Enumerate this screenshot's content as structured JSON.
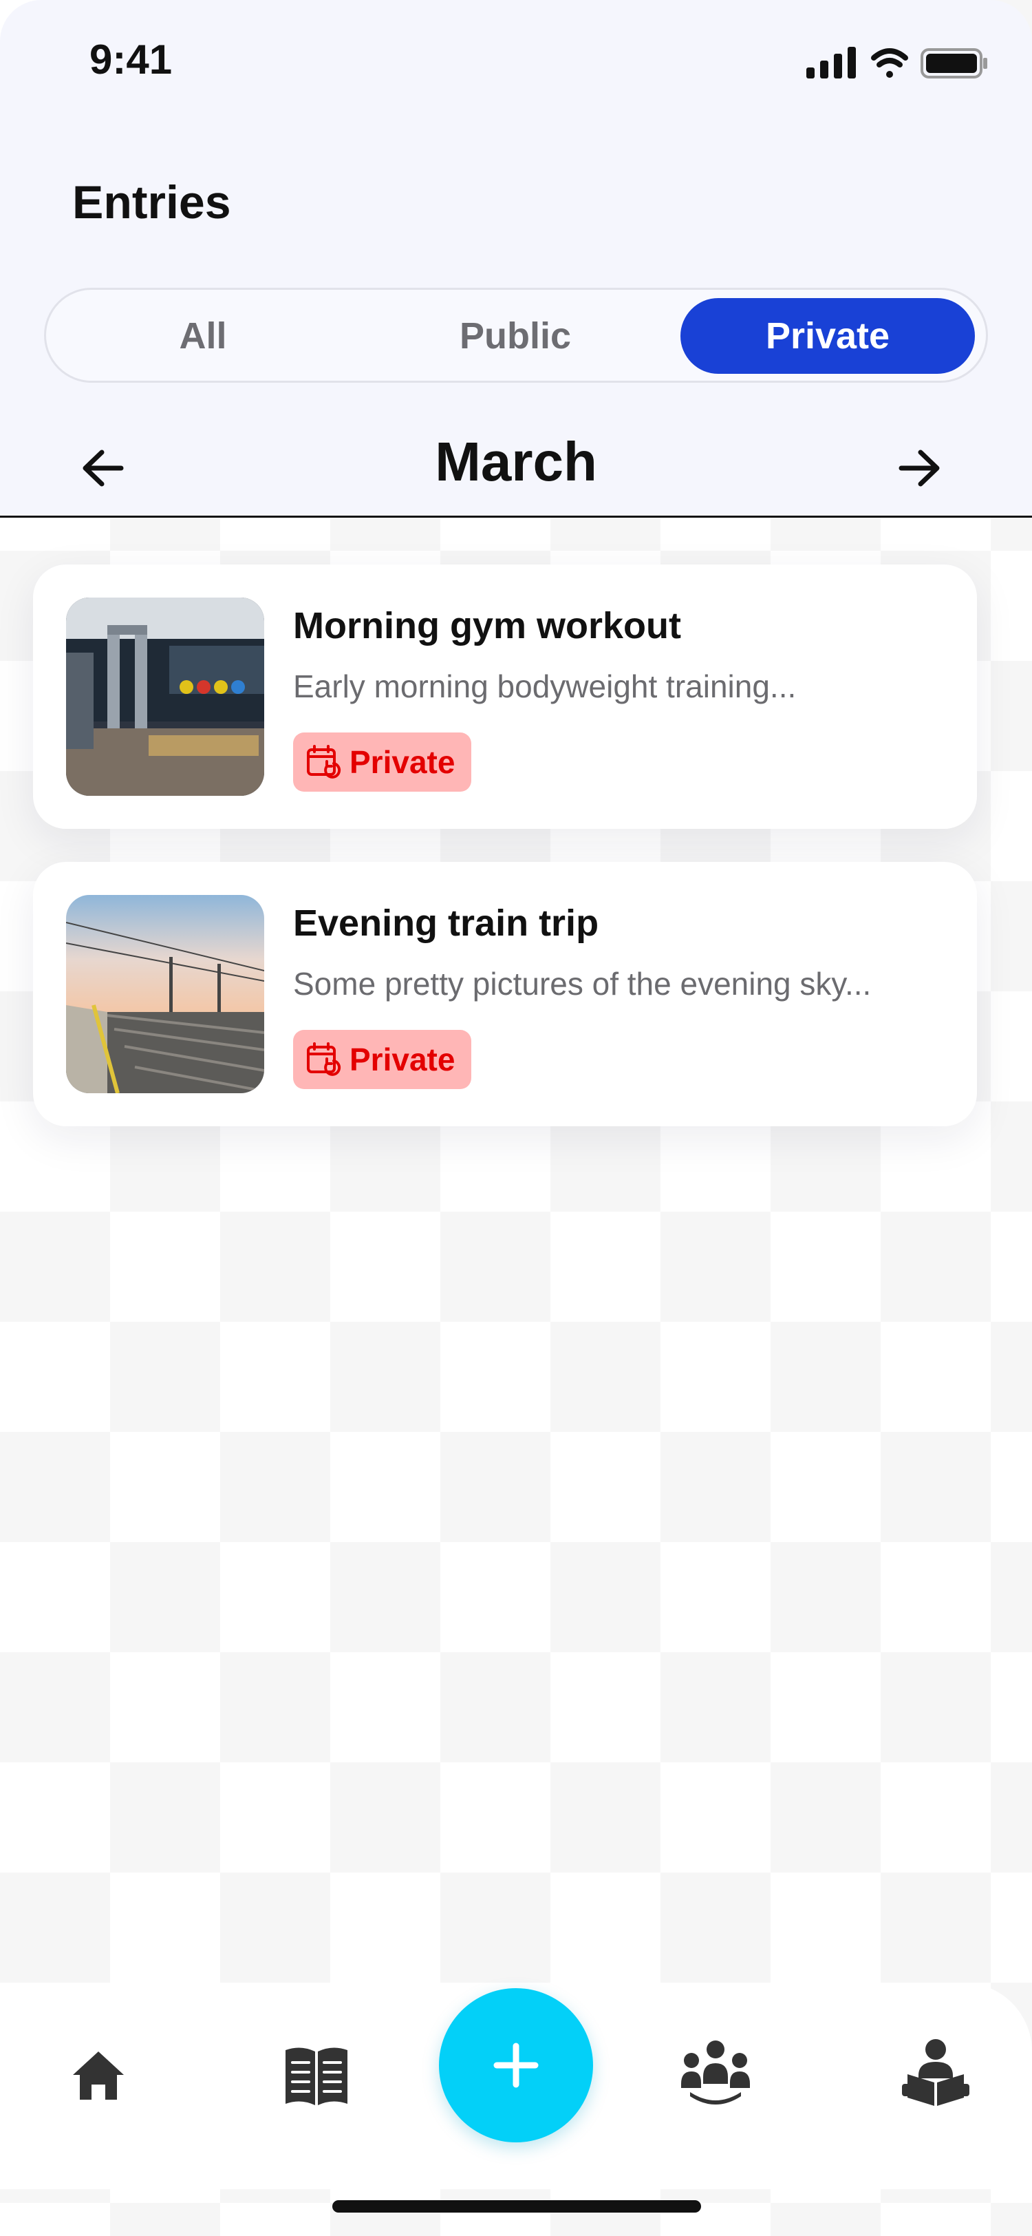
{
  "status_bar": {
    "time": "9:41"
  },
  "header": {
    "title": "Entries",
    "tabs": [
      {
        "label": "All",
        "active": false
      },
      {
        "label": "Public",
        "active": false
      },
      {
        "label": "Private",
        "active": true
      }
    ],
    "month": "March"
  },
  "entries": [
    {
      "title": "Morning gym workout",
      "description": "Early morning bodyweight training...",
      "badge": "Private",
      "image": "gym-photo"
    },
    {
      "title": "Evening train trip",
      "description": "Some pretty pictures of the evening sky...",
      "badge": "Private",
      "image": "train-station-photo"
    }
  ],
  "bottom_nav": {
    "items": [
      "home-icon",
      "journal-icon",
      "add-icon",
      "community-icon",
      "reading-icon"
    ]
  },
  "colors": {
    "accent": "#1941d6",
    "fab": "#03d0f8",
    "badge_bg": "#ffb6b6",
    "badge_text": "#e30000",
    "header_bg": "#f5f6fd"
  }
}
